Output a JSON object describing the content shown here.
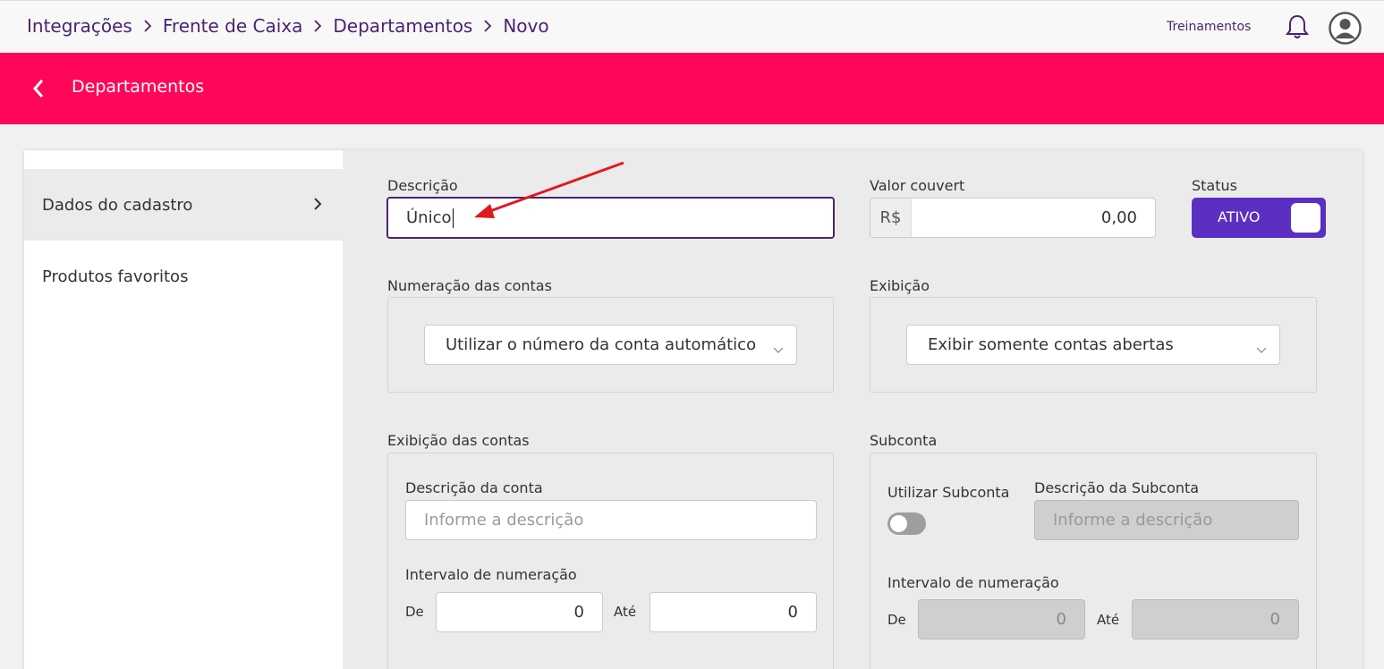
{
  "breadcrumb": [
    "Integrações",
    "Frente de Caixa",
    "Departamentos",
    "Novo"
  ],
  "header": {
    "training_link": "Treinamentos",
    "bell_icon": "bell-icon",
    "avatar_icon": "user-avatar-icon"
  },
  "page_header": {
    "title": "Departamentos",
    "back_icon": "chevron-left-icon"
  },
  "sidebar": {
    "items": [
      {
        "label": "Dados do cadastro",
        "active": true
      },
      {
        "label": "Produtos favoritos",
        "active": false
      }
    ]
  },
  "form": {
    "descricao": {
      "label": "Descrição",
      "value": "Único"
    },
    "valor_couvert": {
      "label": "Valor couvert",
      "prefix": "R$",
      "value": "0,00"
    },
    "status": {
      "label": "Status",
      "value": "ATIVO"
    },
    "numeracao": {
      "label": "Numeração das contas",
      "selected": "Utilizar o número da conta automático"
    },
    "exibicao": {
      "label": "Exibição",
      "selected": "Exibir somente contas abertas"
    },
    "exibicao_contas": {
      "label": "Exibição das contas",
      "descricao_conta_label": "Descrição da conta",
      "descricao_conta_placeholder": "Informe a descrição",
      "intervalo_label": "Intervalo de numeração",
      "de_label": "De",
      "de_value": "0",
      "ate_label": "Até",
      "ate_value": "0"
    },
    "subconta": {
      "label": "Subconta",
      "utilizar_label": "Utilizar Subconta",
      "descricao_label": "Descrição da Subconta",
      "descricao_placeholder": "Informe a descrição",
      "intervalo_label": "Intervalo de numeração",
      "de_label": "De",
      "de_value": "0",
      "ate_label": "Até",
      "ate_value": "0"
    }
  },
  "colors": {
    "brand_red": "#ff0759",
    "brand_purple": "#4a2470",
    "toggle_purple": "#5b2fc1",
    "annotation_arrow": "#e0191f"
  }
}
